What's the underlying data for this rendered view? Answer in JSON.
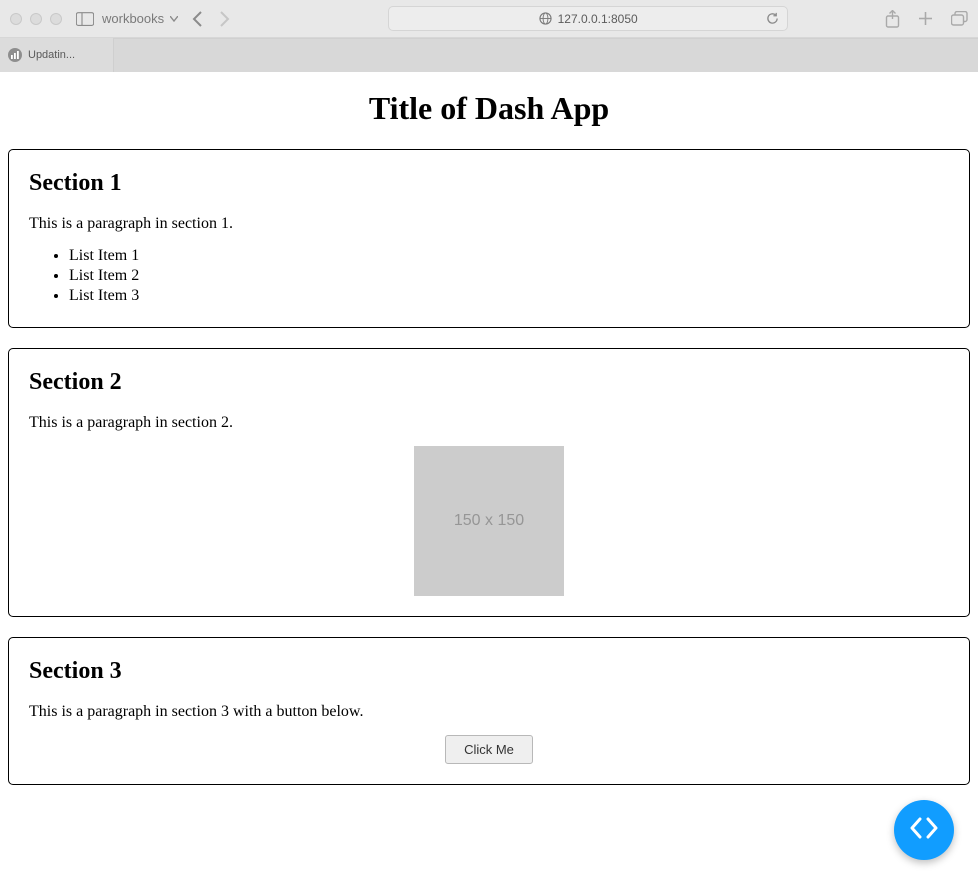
{
  "browser": {
    "bookmark_folder": "workbooks",
    "url": "127.0.0.1:8050",
    "tab_title": "Updatin..."
  },
  "page": {
    "title": "Title of Dash App",
    "sections": [
      {
        "heading": "Section 1",
        "paragraph": "This is a paragraph in section 1.",
        "list": [
          "List Item 1",
          "List Item 2",
          "List Item 3"
        ]
      },
      {
        "heading": "Section 2",
        "paragraph": "This is a paragraph in section 2.",
        "image_label": "150 x 150"
      },
      {
        "heading": "Section 3",
        "paragraph": "This is a paragraph in section 3 with a button below.",
        "button_label": "Click Me"
      }
    ]
  }
}
